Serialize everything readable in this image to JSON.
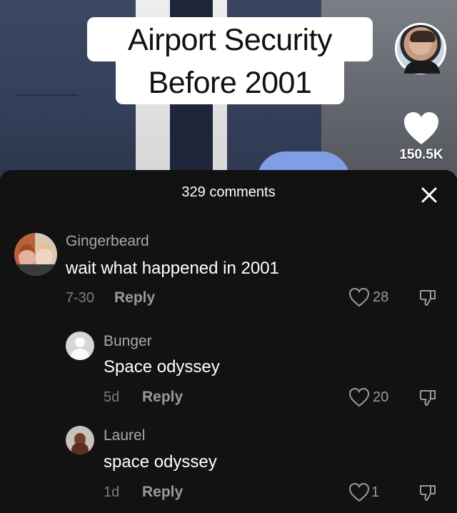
{
  "video": {
    "caption_line1": "Airport Security",
    "caption_line2": "Before 2001",
    "like_count": "150.5K"
  },
  "sheet": {
    "title": "329 comments"
  },
  "comments": [
    {
      "username": "Gingerbeard",
      "text": "wait what happened in 2001",
      "date": "7-30",
      "reply": "Reply",
      "likes": "28"
    },
    {
      "username": "Bunger",
      "text": "Space odyssey",
      "date": "5d",
      "reply": "Reply",
      "likes": "20"
    },
    {
      "username": "Laurel",
      "text": "space odyssey",
      "date": "1d",
      "reply": "Reply",
      "likes": "1"
    }
  ],
  "colors": {
    "sheet_bg": "#121212",
    "caption_bg": "#ffffff",
    "muted_text": "#9a9a9a"
  },
  "icons": [
    "heart-icon",
    "close-icon",
    "dislike-icon",
    "avatar-placeholder-icon"
  ]
}
